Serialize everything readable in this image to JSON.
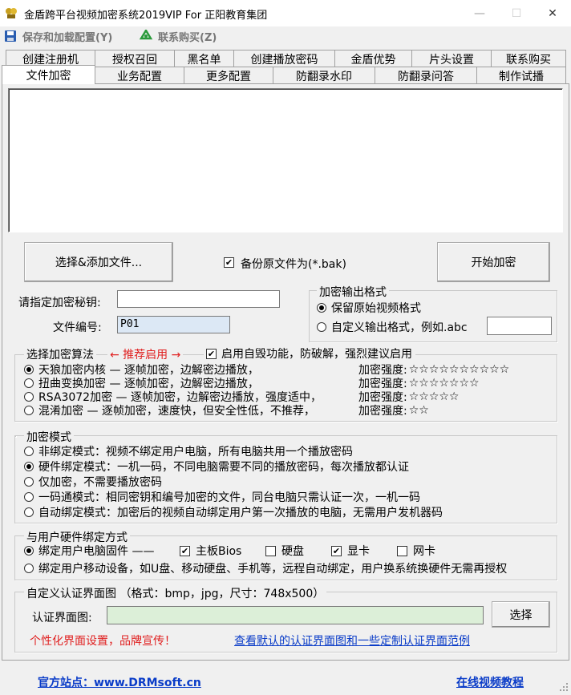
{
  "window": {
    "title": "金盾跨平台视频加密系统2019VIP For 正阳教育集团",
    "minimize": "—",
    "maximize": "☐",
    "close": "✕"
  },
  "menu": {
    "save_config": "保存和加载配置(Y)",
    "buy": "联系购买(Z)"
  },
  "tabs_row1": [
    "创建注册机",
    "授权召回",
    "黑名单",
    "创建播放密码",
    "金盾优势",
    "片头设置",
    "联系购买"
  ],
  "tabs_row2": [
    "文件加密",
    "业务配置",
    "更多配置",
    "防翻录水印",
    "防翻录问答",
    "制作试播"
  ],
  "active_tab": "文件加密",
  "actions": {
    "select_files": "选择&添加文件...",
    "backup_label": "备份原文件为(*.bak)",
    "backup_checked": true,
    "start": "开始加密"
  },
  "key_field": {
    "label": "请指定加密秘钥:",
    "value": ""
  },
  "file_no": {
    "label": "文件编号:",
    "value": "P01"
  },
  "output_format": {
    "title": "加密输出格式",
    "keep": "保留原始视频格式",
    "custom": "自定义输出格式，例如.abc",
    "custom_value": ""
  },
  "algorithm": {
    "title": "选择加密算法",
    "recommend": "← 推荐启用 →",
    "self_destroy": "启用自毁功能，防破解，强烈建议启用",
    "self_destroy_checked": true,
    "options": [
      {
        "label": "天狼加密内核 — 逐帧加密，边解密边播放，",
        "strength_label": "加密强度:",
        "stars": "☆☆☆☆☆☆☆☆☆☆",
        "selected": true
      },
      {
        "label": "扭曲变换加密 — 逐帧加密，边解密边播放，",
        "strength_label": "加密强度:",
        "stars": "☆☆☆☆☆☆☆",
        "selected": false
      },
      {
        "label": "RSA3072加密 — 逐帧加密，边解密边播放，强度适中，",
        "strength_label": "加密强度:",
        "stars": "☆☆☆☆☆",
        "selected": false
      },
      {
        "label": "混淆加密 — 逐帧加密，速度快，但安全性低，不推荐，",
        "strength_label": "加密强度:",
        "stars": "☆☆",
        "selected": false
      }
    ]
  },
  "mode": {
    "title": "加密模式",
    "options": [
      {
        "label": "非绑定模式：视频不绑定用户电脑，所有电脑共用一个播放密码",
        "selected": false
      },
      {
        "label": "硬件绑定模式：一机一码，不同电脑需要不同的播放密码，每次播放都认证",
        "selected": true
      },
      {
        "label": "仅加密，不需要播放密码",
        "selected": false
      },
      {
        "label": "一码通模式：相同密钥和编号加密的文件，同台电脑只需认证一次，一机一码",
        "selected": false
      },
      {
        "label": "自动绑定模式：加密后的视频自动绑定用户第一次播放的电脑，无需用户发机器码",
        "selected": false
      }
    ]
  },
  "binding": {
    "title": "与用户硬件绑定方式",
    "pc_firmware": "绑定用户电脑固件 ——",
    "pc_selected": true,
    "checks": [
      {
        "label": "主板Bios",
        "checked": true
      },
      {
        "label": "硬盘",
        "checked": false
      },
      {
        "label": "显卡",
        "checked": true
      },
      {
        "label": "网卡",
        "checked": false
      }
    ],
    "mobile": "绑定用户移动设备，如U盘、移动硬盘、手机等，远程自动绑定，用户换系统换硬件无需再授权",
    "mobile_selected": false
  },
  "auth_ui": {
    "title": "自定义认证界面图 （格式：bmp，jpg，尺寸：748x500）",
    "label": "认证界面图:",
    "value": "",
    "select": "选择",
    "promo": "个性化界面设置，品牌宣传！",
    "link": "查看默认的认证界面图和一些定制认证界面范例"
  },
  "footer": {
    "site": "官方站点：www.DRMsoft.cn",
    "tutorial": "在线视频教程"
  },
  "colors": {
    "accent_link": "#0a3cc8",
    "red": "#e02020",
    "input_green": "#dcefd8",
    "input_blue": "#dce8f5"
  }
}
